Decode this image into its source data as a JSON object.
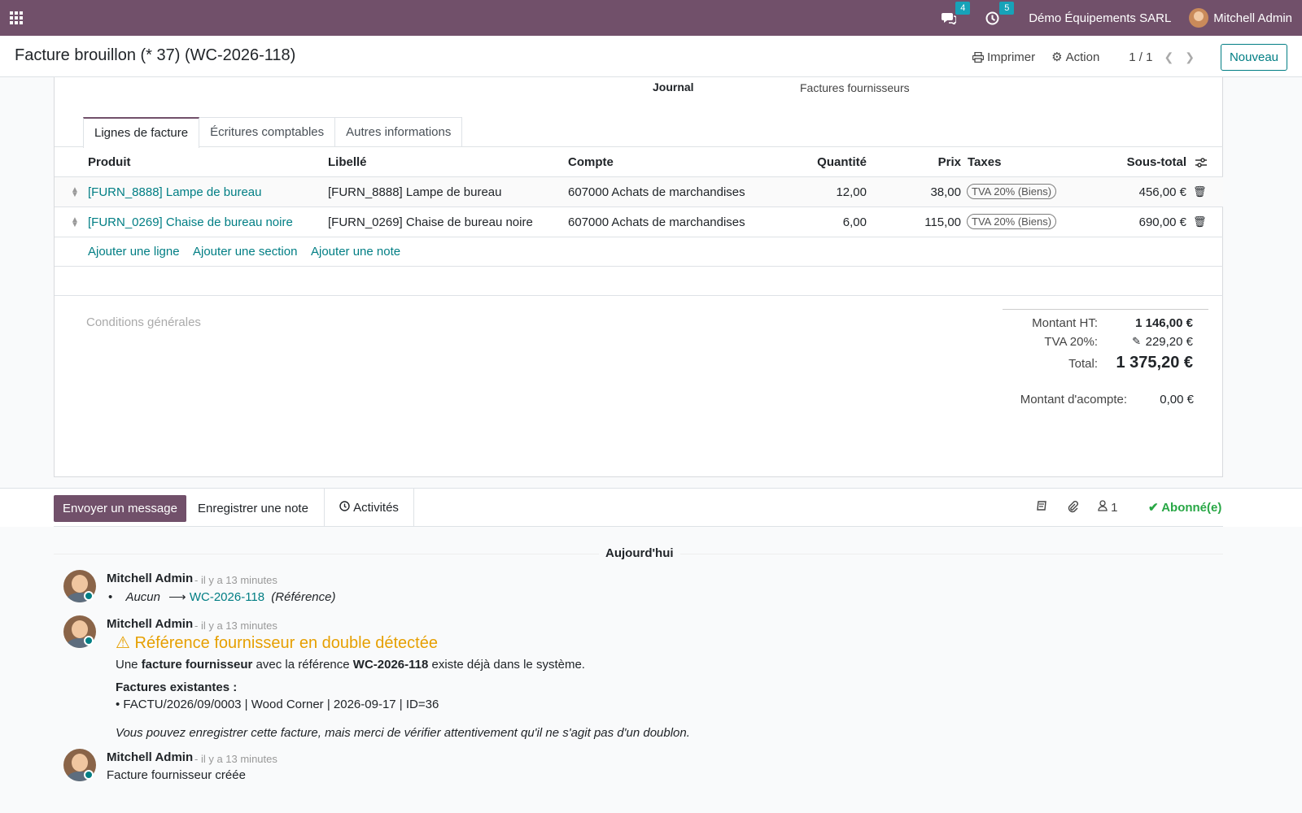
{
  "navbar": {
    "messages_count": "4",
    "activities_count": "5",
    "company": "Démo Équipements SARL",
    "user": "Mitchell Admin"
  },
  "control_panel": {
    "title": "Facture brouillon (* 37) (WC-2026-118)",
    "print": "Imprimer",
    "action": "Action",
    "pager": "1 / 1",
    "new": "Nouveau"
  },
  "form": {
    "journal_label": "Journal",
    "journal_value": "Factures fournisseurs",
    "tabs": [
      "Lignes de facture",
      "Écritures comptables",
      "Autres informations"
    ],
    "columns": {
      "product": "Produit",
      "label": "Libellé",
      "account": "Compte",
      "quantity": "Quantité",
      "price": "Prix",
      "taxes": "Taxes",
      "subtotal": "Sous-total"
    },
    "lines": [
      {
        "product": "[FURN_8888] Lampe de bureau",
        "label": "[FURN_8888] Lampe de bureau",
        "account": "607000 Achats de marchandises",
        "quantity": "12,00",
        "price": "38,00",
        "tax": "TVA 20% (Biens)",
        "subtotal": "456,00 €"
      },
      {
        "product": "[FURN_0269] Chaise de bureau noire",
        "label": "[FURN_0269] Chaise de bureau noire",
        "account": "607000 Achats de marchandises",
        "quantity": "6,00",
        "price": "115,00",
        "tax": "TVA 20% (Biens)",
        "subtotal": "690,00 €"
      }
    ],
    "add_line": "Ajouter une ligne",
    "add_section": "Ajouter une section",
    "add_note": "Ajouter une note",
    "terms_placeholder": "Conditions générales",
    "totals": {
      "untaxed_label": "Montant HT:",
      "untaxed_value": "1 146,00 €",
      "tax_label": "TVA 20%:",
      "tax_value": "229,20 €",
      "total_label": "Total:",
      "total_value": "1 375,20 €",
      "deposit_label": "Montant d'acompte:",
      "deposit_value": "0,00 €"
    }
  },
  "chatter": {
    "send_message": "Envoyer un message",
    "log_note": "Enregistrer une note",
    "activities": "Activités",
    "followers_count": "1",
    "following": "Abonné(e)",
    "day_separator": "Aujourd'hui",
    "messages": [
      {
        "author": "Mitchell Admin",
        "ago": "- il y a 13 minutes",
        "change_from": "Aucun",
        "change_to": "WC-2026-118",
        "change_field": "(Référence)"
      },
      {
        "author": "Mitchell Admin",
        "ago": "- il y a 13 minutes",
        "warning_title": "Référence fournisseur en double détectée",
        "line1_a": "Une ",
        "line1_b": "facture fournisseur",
        "line1_c": " avec la référence ",
        "line1_d": "WC-2026-118",
        "line1_e": " existe déjà dans le système.",
        "existing_title": "Factures existantes :",
        "existing_item": "• FACTU/2026/09/0003 | Wood Corner | 2026-09-17 | ID=36",
        "footer": "Vous pouvez enregistrer cette facture, mais merci de vérifier attentivement qu'il ne s'agit pas d'un doublon."
      },
      {
        "author": "Mitchell Admin",
        "ago": "- il y a 13 minutes",
        "body": "Facture fournisseur créée"
      }
    ]
  },
  "colors": {
    "brand": "#71506a",
    "accent": "#017e84",
    "warning": "#e69f00",
    "success": "#28a745"
  }
}
